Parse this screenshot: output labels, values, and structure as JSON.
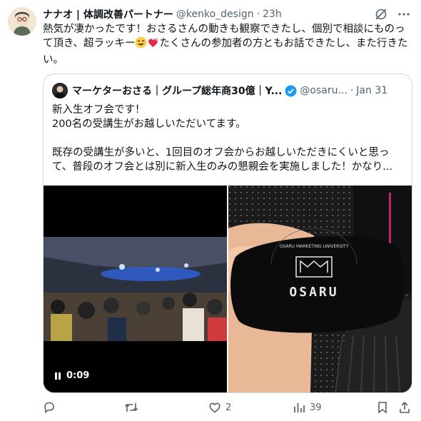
{
  "tweet": {
    "author_name": "ナナオ | 体調改善パートナー",
    "handle": "@kenko_design",
    "separator": "·",
    "time": "23h",
    "text_before_emoji": "熱気が凄かったです！おさるさんの動きも観察できたし、個別で相談にものって頂き、超ラッキー",
    "text_after_emoji": "たくさんの参加者の方ともお話できたし、また行きたい。"
  },
  "quote": {
    "author_name": "マーケターおさる｜グループ総年商30億｜Y...",
    "handle": "@osaru...",
    "separator": "·",
    "date": "Jan 31",
    "lines": [
      "新入生オフ会です！",
      "200名の受講生がお越しいただいてます。",
      "",
      "既存の受講生が多いと、1回目のオフ会からお越しいただきにくいと思って、普段のオフ会とは別に新入生のみの懇親会を実施しました！かなり..."
    ],
    "video_time": "0:09",
    "mask_text_big": "OSARU",
    "mask_text_small": "OSARU MARKETING UNIVERSITY",
    "mask_logo_letters": "OMU"
  },
  "actions": {
    "reply_count": "",
    "retweet_count": "",
    "like_count": "2",
    "views_count": "39"
  },
  "colors": {
    "text_primary": "#0f1419",
    "text_secondary": "#536471",
    "border": "#cfd9de",
    "verified": "#1d9bf0"
  },
  "icons": [
    "grok-icon",
    "more-icon",
    "verified-icon",
    "pause-icon",
    "reply-icon",
    "retweet-icon",
    "like-icon",
    "views-icon",
    "bookmark-icon",
    "share-icon",
    "grinning-emoji",
    "heart-emoji"
  ]
}
